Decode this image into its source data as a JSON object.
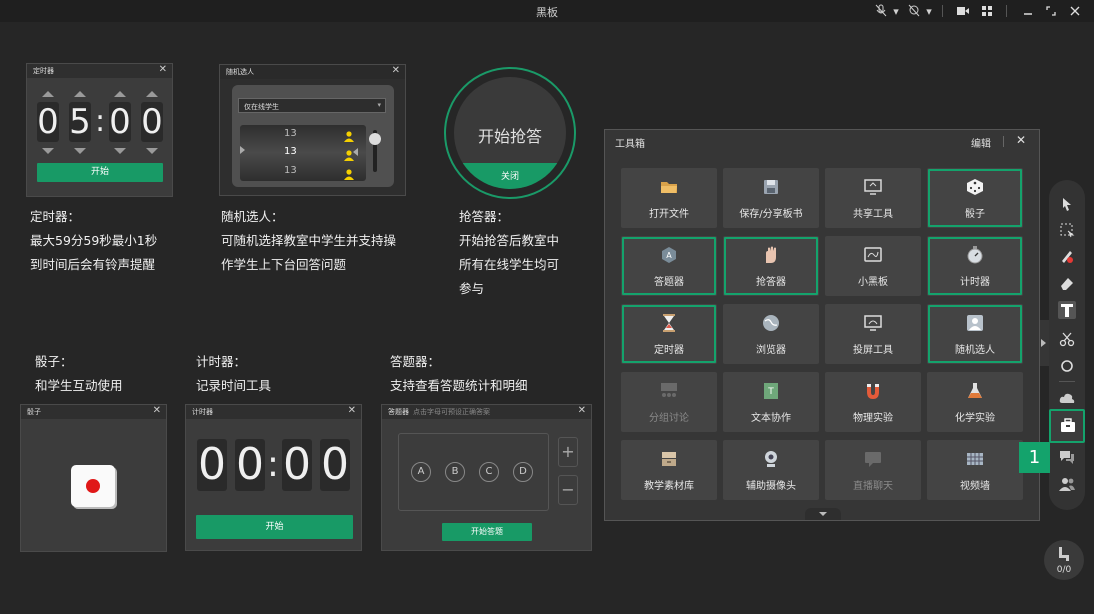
{
  "window": {
    "title": "黑板"
  },
  "timer_panel": {
    "title": "定时器",
    "digits": [
      "0",
      "5",
      "0",
      "0"
    ],
    "colon": ":",
    "start": "开始"
  },
  "random_panel": {
    "title": "随机选人",
    "dropdown": "仅在线学生",
    "rows": [
      "13",
      "13",
      "13"
    ]
  },
  "buzzer_panel": {
    "label": "开始抢答",
    "close": "关闭"
  },
  "desc_timer": {
    "heading": "定时器：",
    "line1": "最大59分59秒最小1秒",
    "line2": "到时间后会有铃声提醒"
  },
  "desc_random": {
    "heading": "随机选人：",
    "line1": "可随机选择教室中学生并支持操",
    "line2": "作学生上下台回答问题"
  },
  "desc_buzzer": {
    "heading": "抢答器：",
    "line1": "开始抢答后教室中",
    "line2": "所有在线学生均可",
    "line3": "参与"
  },
  "desc_dice": {
    "heading": "骰子：",
    "line1": "和学生互动使用"
  },
  "desc_stopwatch": {
    "heading": "计时器：",
    "line1": "记录时间工具"
  },
  "desc_answer": {
    "heading": "答题器：",
    "line1": "支持查看答题统计和明细"
  },
  "dice_panel": {
    "title": "骰子"
  },
  "stopwatch_panel": {
    "title": "计时器",
    "digits": [
      "0",
      "0",
      "0",
      "0"
    ],
    "colon": ":",
    "start": "开始"
  },
  "answer_panel": {
    "title": "答题器",
    "hint": "点击字母可预设正确答案",
    "options": [
      "A",
      "B",
      "C",
      "D"
    ],
    "plus": "+",
    "minus": "−",
    "start": "开始答题"
  },
  "toolbox": {
    "title": "工具箱",
    "edit": "编辑",
    "close": "✕",
    "tools": [
      "打开文件",
      "保存/分享板书",
      "共享工具",
      "骰子",
      "答题器",
      "抢答器",
      "小黑板",
      "计时器",
      "定时器",
      "浏览器",
      "投屏工具",
      "随机选人",
      "分组讨论",
      "文本协作",
      "物理实验",
      "化学实验",
      "教学素材库",
      "辅助摄像头",
      "直播聊天",
      "视频墙"
    ]
  },
  "dock": {
    "badge": "1",
    "count": "0/0"
  },
  "colors": {
    "accent": "#14a36c",
    "bg": "#262626",
    "panel": "#3c3c3c"
  }
}
